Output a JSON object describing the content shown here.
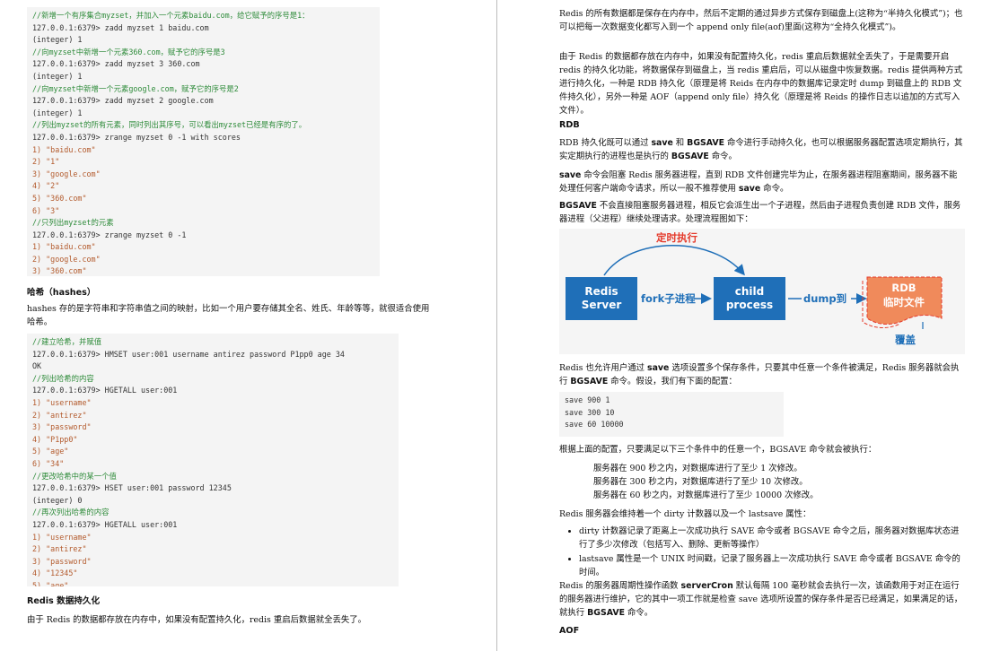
{
  "left": {
    "code1": [
      {
        "t": "c",
        "v": "//新增一个有序集合myzset，并加入一个元素baidu.com，给它赋予的序号是1："
      },
      {
        "t": "n",
        "v": "127.0.0.1:6379> zadd myzset 1 baidu.com"
      },
      {
        "t": "n",
        "v": "(integer) 1"
      },
      {
        "t": "c",
        "v": "//向myzset中新增一个元素360.com，赋予它的序号是3"
      },
      {
        "t": "n",
        "v": "127.0.0.1:6379> zadd myzset 3 360.com"
      },
      {
        "t": "n",
        "v": "(integer) 1"
      },
      {
        "t": "c",
        "v": "//向myzset中新增一个元素google.com，赋予它的序号是2"
      },
      {
        "t": "n",
        "v": "127.0.0.1:6379> zadd myzset 2 google.com"
      },
      {
        "t": "n",
        "v": "(integer) 1"
      },
      {
        "t": "c",
        "v": "//列出myzset的所有元素，同时列出其序号，可以看出myzset已经是有序的了。"
      },
      {
        "t": "n",
        "v": "127.0.0.1:6379> zrange myzset 0 -1 with scores"
      },
      {
        "t": "s",
        "v": "1) \"baidu.com\""
      },
      {
        "t": "s",
        "v": "2) \"1\""
      },
      {
        "t": "s",
        "v": "3) \"google.com\""
      },
      {
        "t": "s",
        "v": "4) \"2\""
      },
      {
        "t": "s",
        "v": "5) \"360.com\""
      },
      {
        "t": "s",
        "v": "6) \"3\""
      },
      {
        "t": "c",
        "v": "//只列出myzset的元素"
      },
      {
        "t": "n",
        "v": "127.0.0.1:6379> zrange myzset 0 -1"
      },
      {
        "t": "s",
        "v": "1) \"baidu.com\""
      },
      {
        "t": "s",
        "v": "2) \"google.com\""
      },
      {
        "t": "s",
        "v": "3) \"360.com\""
      }
    ],
    "hash_heading": "哈希（hashes）",
    "hash_para": "hashes 存的是字符串和字符串值之间的映射，比如一个用户要存储其全名、姓氏、年龄等等，就很适合使用哈希。",
    "code2": [
      {
        "t": "c",
        "v": "//建立哈希，并赋值"
      },
      {
        "t": "n",
        "v": "127.0.0.1:6379> HMSET user:001 username antirez password P1pp0 age 34"
      },
      {
        "t": "n",
        "v": "OK"
      },
      {
        "t": "c",
        "v": "//列出哈希的内容"
      },
      {
        "t": "n",
        "v": "127.0.0.1:6379> HGETALL user:001"
      },
      {
        "t": "s",
        "v": "1) \"username\""
      },
      {
        "t": "s",
        "v": "2) \"antirez\""
      },
      {
        "t": "s",
        "v": "3) \"password\""
      },
      {
        "t": "s",
        "v": "4) \"P1pp0\""
      },
      {
        "t": "s",
        "v": "5) \"age\""
      },
      {
        "t": "s",
        "v": "6) \"34\""
      },
      {
        "t": "c",
        "v": "//更改哈希中的某一个值"
      },
      {
        "t": "n",
        "v": "127.0.0.1:6379> HSET user:001 password 12345"
      },
      {
        "t": "n",
        "v": "(integer) 0"
      },
      {
        "t": "c",
        "v": "//再次列出哈希的内容"
      },
      {
        "t": "n",
        "v": "127.0.0.1:6379> HGETALL user:001"
      },
      {
        "t": "s",
        "v": "1) \"username\""
      },
      {
        "t": "s",
        "v": "2) \"antirez\""
      },
      {
        "t": "s",
        "v": "3) \"password\""
      },
      {
        "t": "s",
        "v": "4) \"12345\""
      },
      {
        "t": "s",
        "v": "5) \"age\""
      },
      {
        "t": "s",
        "v": "6) \"34\""
      }
    ],
    "persist_heading": "Redis 数据持久化",
    "persist_para": "由于 Redis 的数据都存放在内存中，如果没有配置持久化，redis 重启后数据就全丢失了。"
  },
  "right": {
    "para1": "Redis 的所有数据都是保存在内存中，然后不定期的通过异步方式保存到磁盘上(这称为“半持久化模式”)；也可以把每一次数据变化都写入到一个 append only file(aof)里面(这称为“全持久化模式”)。",
    "para2": "由于 Redis 的数据都存放在内存中，如果没有配置持久化，redis 重启后数据就全丢失了，于是需要开启 redis 的持久化功能，将数据保存到磁盘上，当 redis 重启后，可以从磁盘中恢复数据。redis 提供两种方式进行持久化，一种是 RDB 持久化（原理是将 Reids 在内存中的数据库记录定时 dump 到磁盘上的 RDB 文件持久化），另外一种是 AOF（append only file）持久化（原理是将 Reids 的操作日志以追加的方式写入文件）。",
    "rdb_heading": "RDB",
    "rdb_para_a": "RDB 持久化既可以通过 ",
    "rdb_b1": "save",
    "rdb_para_b": " 和 ",
    "rdb_b2": "BGSAVE",
    "rdb_para_c": " 命令进行手动持久化，也可以根据服务器配置选项定期执行，其实定期执行的进程也是执行的 ",
    "rdb_b3": "BGSAVE",
    "rdb_para_d": " 命令。",
    "save_b": "save",
    "save_para_a": " 命令会阻塞 Redis 服务器进程，直到 RDB 文件创建完毕为止，在服务器进程阻塞期间，服务器不能处理任何客户端命令请求，所以一般不推荐使用 ",
    "save_b2": "save",
    "save_para_b": " 命令。",
    "bgsave_b": "BGSAVE",
    "bgsave_para": " 不会直接阻塞服务器进程，相反它会派生出一个子进程，然后由子进程负责创建 RDB 文件，服务器进程（父进程）继续处理请求。处理流程图如下：",
    "diagram": {
      "timer_label": "定时执行",
      "redis_line1": "Redis",
      "redis_line2": "Server",
      "fork_label": "fork子进程",
      "child_line1": "child",
      "child_line2": "process",
      "dump_label": "dump到",
      "file_line1": "RDB",
      "file_line2": "临时文件",
      "cover_label": "覆盖",
      "colors": {
        "box": "#1f6fb8",
        "accent": "#e53b2c",
        "file": "#f08a5b"
      }
    },
    "cond_para_a": "Redis 也允许用户通过 ",
    "cond_b1": "save",
    "cond_para_b": " 选项设置多个保存条件，只要其中任意一个条件被满足，Redis 服务器就会执行 ",
    "cond_b2": "BGSAVE",
    "cond_para_c": " 命令。假设，我们有下面的配置：",
    "config_lines": [
      "save 900 1",
      "save 300 10",
      "save 60 10000"
    ],
    "cond_intro": "根据上面的配置，只要满足以下三个条件中的任意一个，BGSAVE 命令就会被执行：",
    "conditions": [
      "服务器在 900 秒之内，对数据库进行了至少 1 次修改。",
      "服务器在 300 秒之内，对数据库进行了至少 10 次修改。",
      "服务器在 60 秒之内，对数据库进行了至少 10000 次修改。"
    ],
    "dirty_intro": "Redis 服务器会维持着一个 dirty 计数器以及一个 lastsave 属性：",
    "bullets": [
      "dirty 计数器记录了距离上一次成功执行 SAVE 命令或者 BGSAVE 命令之后，服务器对数据库状态进行了多少次修改（包括写入、删除、更新等操作）",
      "lastsave 属性是一个 UNIX 时间戳，记录了服务器上一次成功执行 SAVE 命令或者 BGSAVE 命令的时间。"
    ],
    "cron_para_a": "Redis 的服务器周期性操作函数 ",
    "cron_b": "serverCron",
    "cron_para_b": " 默认每隔 100 毫秒就会去执行一次，该函数用于对正在运行的服务器进行维护，它的其中一项工作就是检查 save 选项所设置的保存条件是否已经满足，如果满足的话，就执行 ",
    "cron_b2": "BGSAVE",
    "cron_para_c": " 命令。",
    "aof_heading": "AOF"
  }
}
